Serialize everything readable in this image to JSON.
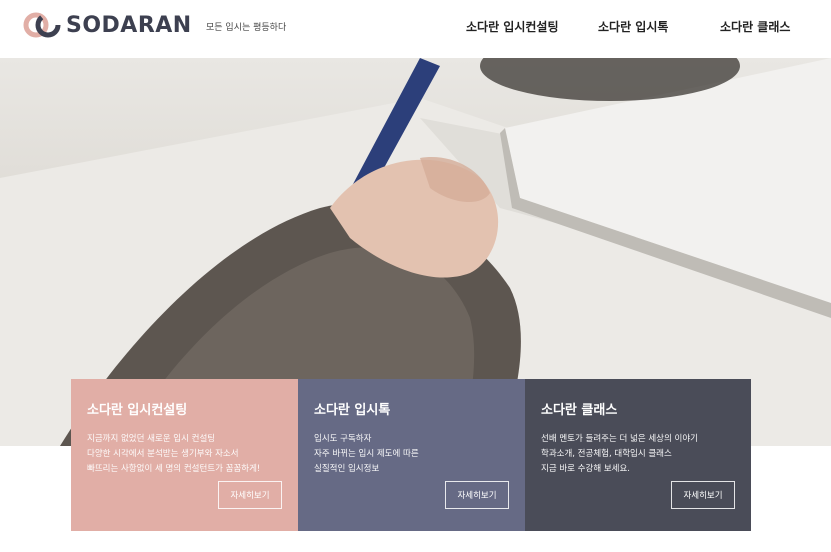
{
  "header": {
    "logo_text": "SODARAN",
    "tagline": "모든 입시는 평등하다",
    "nav": [
      {
        "label": "소다란 입시컨설팅"
      },
      {
        "label": "소다란 입시톡"
      },
      {
        "label": "소다란 클래스"
      }
    ]
  },
  "cards": [
    {
      "title": "소다란 입시컨설팅",
      "lines": [
        "지금까지 없었던 새로운 입시 컨설팅",
        "다양한 시각에서 분석받는 생기부와 자소서",
        "빠뜨리는 사항없이 세 명의 컨설턴트가 꼼꼼하게!"
      ],
      "button": "자세히보기",
      "color": "#e1aea6"
    },
    {
      "title": "소다란 입시톡",
      "lines": [
        "입시도 구독하자",
        "자주 바뀌는 입시 제도에 따른",
        "실질적인 입시정보"
      ],
      "button": "자세히보기",
      "color": "#666a85"
    },
    {
      "title": "소다란 클래스",
      "lines": [
        "선배 멘토가 들려주는 더 넓은 세상의 이야기",
        "학과소개, 전공체험, 대학입시 클래스",
        "지금 바로 수강해 보세요."
      ],
      "button": "자세히보기",
      "color": "#4a4c58"
    }
  ],
  "colors": {
    "brand_dark": "#3d4050",
    "brand_pink": "#e1aea6"
  }
}
